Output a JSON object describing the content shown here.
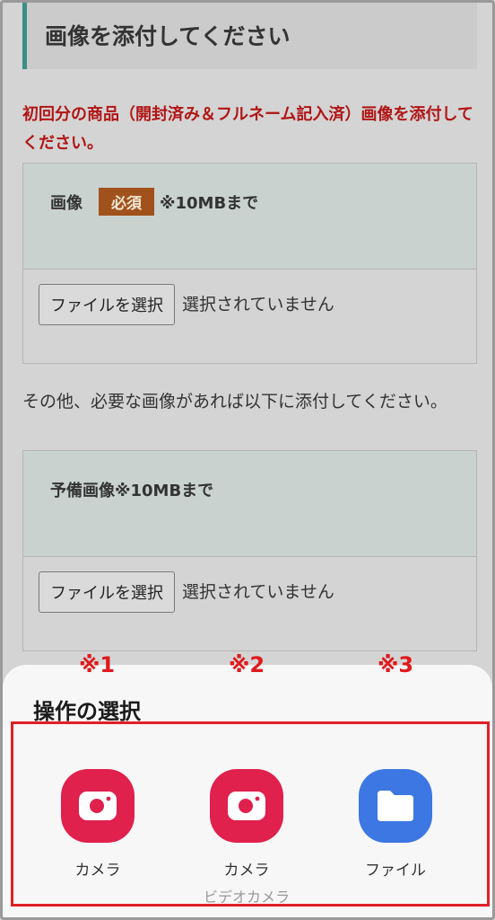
{
  "section": {
    "title": "画像を添付してください"
  },
  "notice": "初回分の商品（開封済み＆フルネーム記入済）画像を添付してください。",
  "image_field": {
    "label": "画像",
    "required_badge": "必須",
    "size_note": "※10MBまで",
    "button_label": "ファイルを選択",
    "status": "選択されていません"
  },
  "other_text": "その他、必要な画像があれば以下に添付してください。",
  "spare_field": {
    "label": "予備画像※10MBまで",
    "button_label": "ファイルを選択",
    "status": "選択されていません"
  },
  "markers": [
    "※1",
    "※2",
    "※3"
  ],
  "sheet": {
    "title": "操作の選択",
    "options": [
      {
        "label": "カメラ",
        "sublabel": "",
        "icon": "camera-icon"
      },
      {
        "label": "カメラ",
        "sublabel": "ビデオカメラ",
        "icon": "camera-icon"
      },
      {
        "label": "ファイル",
        "sublabel": "",
        "icon": "folder-icon"
      }
    ]
  },
  "colors": {
    "notice_red": "#b11515",
    "badge_brown": "#a1521c",
    "camera_red": "#e0204d",
    "files_blue": "#3c77e3",
    "highlight_red": "#e02027"
  }
}
